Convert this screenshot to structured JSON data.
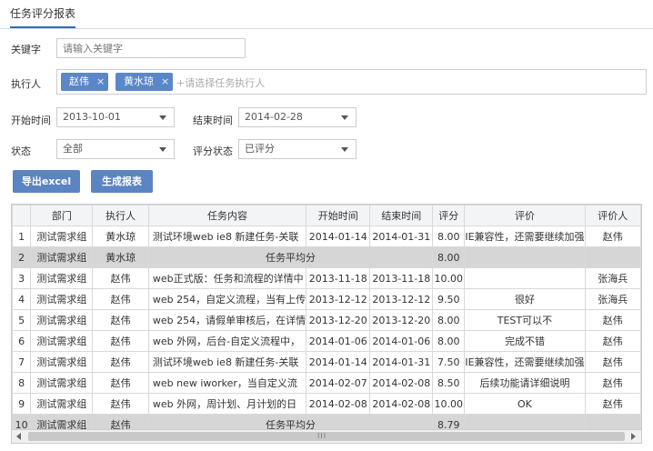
{
  "page": {
    "tab_title": "任务评分报表"
  },
  "filters": {
    "keyword": {
      "label": "关键字",
      "placeholder": "请输入关键字"
    },
    "executor": {
      "label": "执行人",
      "tags": [
        "赵伟",
        "黄水琼"
      ],
      "remove_glyph": "×",
      "placeholder": "+请选择任务执行人"
    },
    "start_time": {
      "label": "开始时间",
      "value": "2013-10-01"
    },
    "end_time": {
      "label": "结束时间",
      "value": "2014-02-28"
    },
    "status": {
      "label": "状态",
      "value": "全部"
    },
    "score_status": {
      "label": "评分状态",
      "value": "已评分"
    }
  },
  "actions": {
    "export_label": "导出excel",
    "generate_label": "生成报表"
  },
  "table": {
    "headers": [
      "",
      "部门",
      "执行人",
      "任务内容",
      "开始时间",
      "结束时间",
      "评分",
      "评价",
      "评价人"
    ],
    "rows": [
      {
        "n": "1",
        "dept": "测试需求组",
        "exec": "黄水琼",
        "content": "测试环境web ie8 新建任务-关联",
        "start": "2014-01-14",
        "end": "2014-01-31",
        "score": "8.00",
        "comment": "IE兼容性，还需要继续加强",
        "rater": "赵伟"
      },
      {
        "n": "2",
        "dept": "测试需求组",
        "exec": "黄水琼",
        "avg_label": "任务平均分",
        "score": "8.00",
        "summary": true
      },
      {
        "n": "3",
        "dept": "测试需求组",
        "exec": "赵伟",
        "content": "web正式版：任务和流程的详情中",
        "start": "2013-11-18",
        "end": "2013-11-18",
        "score": "10.00",
        "comment": "",
        "rater": "张海兵"
      },
      {
        "n": "4",
        "dept": "测试需求组",
        "exec": "赵伟",
        "content": "web 254，自定义流程，当有上传",
        "start": "2013-12-12",
        "end": "2013-12-12",
        "score": "9.50",
        "comment": "很好",
        "rater": "张海兵"
      },
      {
        "n": "5",
        "dept": "测试需求组",
        "exec": "赵伟",
        "content": "web 254，请假单审核后，在详情",
        "start": "2013-12-20",
        "end": "2013-12-20",
        "score": "8.00",
        "comment": "TEST可以不",
        "rater": "赵伟"
      },
      {
        "n": "6",
        "dept": "测试需求组",
        "exec": "赵伟",
        "content": "web 外网，后台-自定义流程中，",
        "start": "2014-01-06",
        "end": "2014-01-06",
        "score": "8.00",
        "comment": "完成不错",
        "rater": "赵伟"
      },
      {
        "n": "7",
        "dept": "测试需求组",
        "exec": "赵伟",
        "content": "测试环境web ie8 新建任务-关联",
        "start": "2014-01-14",
        "end": "2014-01-31",
        "score": "7.50",
        "comment": "IE兼容性，还需要继续加强",
        "rater": "赵伟"
      },
      {
        "n": "8",
        "dept": "测试需求组",
        "exec": "赵伟",
        "content": "web new iworker，当自定义流",
        "start": "2014-02-07",
        "end": "2014-02-08",
        "score": "8.50",
        "comment": "后续功能请详细说明",
        "rater": "赵伟"
      },
      {
        "n": "9",
        "dept": "测试需求组",
        "exec": "赵伟",
        "content": "web 外网，周计划、月计划的日",
        "start": "2014-02-08",
        "end": "2014-02-08",
        "score": "10.00",
        "comment": "OK",
        "rater": "赵伟"
      },
      {
        "n": "10",
        "dept": "测试需求组",
        "exec": "赵伟",
        "avg_label": "任务平均分",
        "score": "8.79",
        "summary": true
      }
    ]
  },
  "scrollbar": {
    "grip": "III"
  }
}
